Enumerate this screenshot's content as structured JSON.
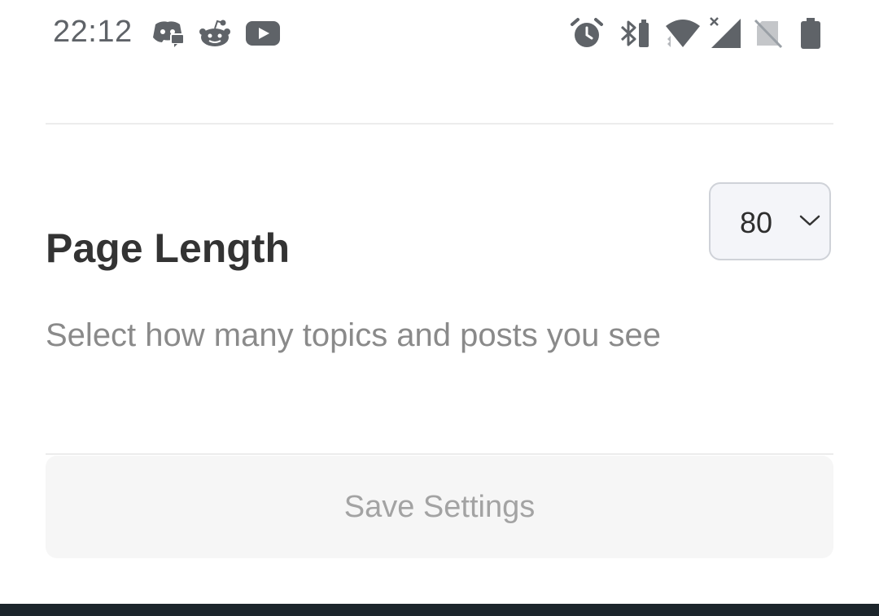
{
  "status_bar": {
    "time": "22:12",
    "left_icons": [
      "discord-icon",
      "reddit-icon",
      "youtube-icon"
    ],
    "right_icons": [
      "alarm-icon",
      "bluetooth-battery-icon",
      "wifi-icon",
      "cellular-signal-icon",
      "no-sim-icon",
      "battery-icon"
    ],
    "color": "#5f6368"
  },
  "setting": {
    "title": "Page Length",
    "description": "Select how many topics and posts you see",
    "select": {
      "value": "80"
    }
  },
  "actions": {
    "save_label": "Save Settings"
  },
  "colors": {
    "title": "#333333",
    "description": "#8a8a8a",
    "button_bg": "#f6f6f6",
    "button_text": "#a3a3a3",
    "nav_bar": "#1c252b"
  }
}
